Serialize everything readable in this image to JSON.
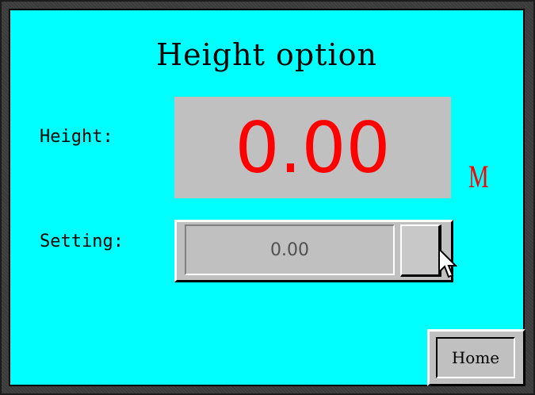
{
  "screen": {
    "title": "Height option",
    "background_color": "#00ffff"
  },
  "height": {
    "label": "Height:",
    "value": "0.00",
    "unit": "M",
    "value_color": "#ff0000"
  },
  "setting": {
    "label": "Setting:",
    "value": "0.00",
    "button_icon": "keypad-button-icon"
  },
  "home_button": {
    "label": "Home"
  },
  "cursor": {
    "icon": "mouse-pointer-icon"
  }
}
